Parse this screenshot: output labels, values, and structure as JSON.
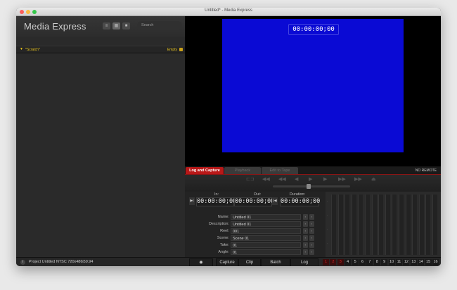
{
  "window": {
    "title": "Untitled* - Media Express"
  },
  "sidebar": {
    "brand": "Media Express",
    "search_placeholder": "Search",
    "bin": {
      "arrow": "▼",
      "name": "*Scratch*",
      "status": "Empty"
    }
  },
  "viewer": {
    "timecode": "00:00:00;00",
    "background_color": "#0a0ad4"
  },
  "tabs": [
    {
      "label": "Log and Capture",
      "active": true
    },
    {
      "label": "Playback",
      "active": false
    },
    {
      "label": "Edit to Tape",
      "active": false
    }
  ],
  "remote_status": "NO REMOTE",
  "timecodes": {
    "in_label": "In:",
    "in_value": "00:00:00;00",
    "out_label": "Out:",
    "out_value": "00:00:00;00",
    "duration_label": "Duration:",
    "duration_value": "00:00:00;00"
  },
  "fields": [
    {
      "label": "Name:",
      "value": "Untitled 01"
    },
    {
      "label": "Description:",
      "value": "Untitled 01"
    },
    {
      "label": "Reel:",
      "value": "001"
    },
    {
      "label": "Scene:",
      "value": "Scene 01"
    },
    {
      "label": "Take:",
      "value": "01"
    },
    {
      "label": "Angle:",
      "value": "01"
    }
  ],
  "footer": {
    "project_text": "Project Untitled NTSC 720x486i59.94",
    "buttons": {
      "capture": "Capture",
      "clip": "Clip",
      "batch": "Batch",
      "log": "Log"
    },
    "channels": [
      "1",
      "2",
      "3",
      "4",
      "5",
      "6",
      "7",
      "8",
      "9",
      "10",
      "11",
      "12",
      "13",
      "14",
      "15",
      "16"
    ],
    "active_channels": 3
  },
  "colors": {
    "accent_red": "#b81818",
    "accent_yellow": "#e6c21f"
  }
}
